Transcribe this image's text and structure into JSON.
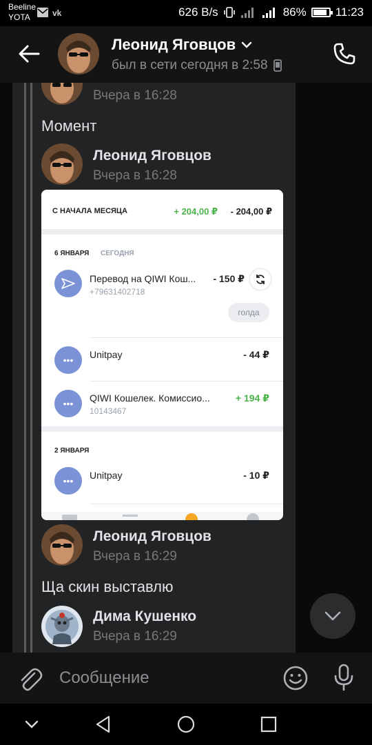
{
  "status_bar": {
    "carrier_line1": "Beeline",
    "carrier_line2": "YOTA",
    "net_speed": "626 B/s",
    "battery": "86%",
    "battery_level": 0.86,
    "time": "11:23"
  },
  "header": {
    "contact_name": "Леонид Яговцов",
    "last_seen": "был в сети сегодня в 2:58"
  },
  "messages": [
    {
      "time": "Вчера в 16:28"
    },
    {
      "text": "Момент"
    },
    {
      "author": "Леонид Яговцов",
      "time": "Вчера в 16:28"
    },
    {
      "author": "Леонид Яговцов",
      "time": "Вчера в 16:29",
      "text": "Ща скин выставлю"
    },
    {
      "author": "Дима Кушенко",
      "time": "Вчера в 16:29"
    }
  ],
  "attachment": {
    "period_label": "С НАЧАЛА МЕСЯЦА",
    "income": "+ 204,00 ₽",
    "expense": "- 204,00 ₽",
    "groups": [
      {
        "date": "6 ЯНВАРЯ",
        "tag": "СЕГОДНЯ",
        "transactions": [
          {
            "name": "Перевод на QIWI Кош...",
            "sub": "+79631402718",
            "amount": "- 150 ₽",
            "comment": "голда"
          },
          {
            "name": "Unitpay",
            "amount": "- 44 ₽"
          },
          {
            "name": "QIWI Кошелек. Комиссио...",
            "sub": "10143467",
            "amount": "+ 194 ₽"
          }
        ]
      },
      {
        "date": "2 ЯНВАРЯ",
        "transactions": [
          {
            "name": "Unitpay",
            "amount": "- 10 ₽"
          }
        ]
      }
    ]
  },
  "composer": {
    "placeholder": "Сообщение"
  },
  "icons": {
    "back": "arrow-left-icon",
    "call": "phone-icon",
    "attach": "paperclip-icon",
    "emoji": "smile-icon",
    "mic": "microphone-icon",
    "scroll": "chevron-down-icon"
  },
  "colors": {
    "accent_green": "#4bb34b",
    "qiwi_icon": "#7b93d6",
    "panel": "#222324"
  }
}
